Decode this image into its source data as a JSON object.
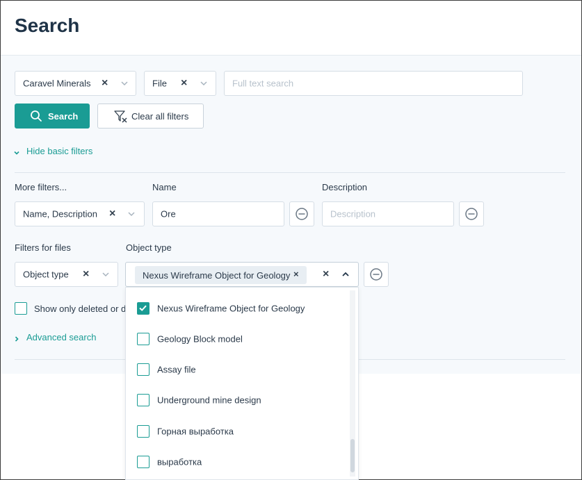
{
  "page": {
    "title": "Search"
  },
  "basic_filters": {
    "company": {
      "value": "Caravel Minerals",
      "clear": "×"
    },
    "type": {
      "value": "File",
      "clear": "×"
    },
    "full_text": {
      "placeholder": "Full text search"
    }
  },
  "actions": {
    "search_label": "Search",
    "clear_label": "Clear all filters",
    "hide_basic_label": "Hide basic filters"
  },
  "more_filters": {
    "label": "More filters...",
    "value": "Name, Description",
    "clear": "×",
    "name_label": "Name",
    "name_value": "Ore",
    "description_label": "Description",
    "description_placeholder": "Description"
  },
  "file_filters": {
    "label": "Filters for files",
    "value": "Object type",
    "clear": "×",
    "object_type_label": "Object type",
    "object_type_tag": "Nexus Wireframe Object for Geology",
    "tag_remove": "×",
    "clear_all": "×"
  },
  "deleted_checkbox_label": "Show only deleted or da",
  "advanced_search_label": "Advanced search",
  "object_type_options": [
    {
      "label": "Nexus Wireframe Object for Geology",
      "checked": true
    },
    {
      "label": "Geology Block model",
      "checked": false
    },
    {
      "label": "Assay file",
      "checked": false
    },
    {
      "label": "Underground mine design",
      "checked": false
    },
    {
      "label": "Горная выработка",
      "checked": false
    },
    {
      "label": "выработка",
      "checked": false
    }
  ],
  "colors": {
    "accent": "#1a9c94",
    "title": "#1f3347",
    "panel_bg": "#f6f9fc"
  },
  "icons": {
    "search": "search-icon",
    "clear_filter": "filter-clear-icon",
    "chevron_down": "chevron-down-icon",
    "chevron_up": "chevron-up-icon",
    "chevron_right": "chevron-right-icon",
    "remove": "minus-circle-icon",
    "check": "check-icon"
  }
}
